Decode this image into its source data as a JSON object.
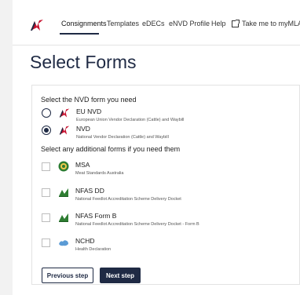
{
  "nav": {
    "items": [
      "Consignments",
      "Templates",
      "eDECs",
      "eNVD Profile",
      "Help"
    ],
    "external_link": "Take me to myMLA",
    "active_index": 0
  },
  "page": {
    "title": "Select Forms"
  },
  "nvd_section": {
    "heading": "Select the NVD form you need",
    "options": [
      {
        "label": "EU NVD",
        "desc": "European Union Vendor Declaration (Cattle) and Waybill",
        "checked": false
      },
      {
        "label": "NVD",
        "desc": "National Vendor Declaration (Cattle) and Waybill",
        "checked": true
      }
    ]
  },
  "additional_section": {
    "heading": "Select any additional forms if you need them",
    "options": [
      {
        "label": "MSA",
        "desc": "Meat Standards Australia",
        "icon": "msa-icon"
      },
      {
        "label": "NFAS DD",
        "desc": "National Feedlot Accreditation Scheme Delivery Docket",
        "icon": "nfas-icon"
      },
      {
        "label": "NFAS Form B",
        "desc": "National Feedlot Accreditation Scheme Delivery Docket - Form B",
        "icon": "nfas-icon"
      },
      {
        "label": "NCHD",
        "desc": "Health Declaration",
        "icon": "nchd-icon"
      }
    ]
  },
  "buttons": {
    "previous": "Previous step",
    "next": "Next step"
  },
  "colors": {
    "primary": "#1f2a44",
    "logo_red": "#c8102e"
  }
}
